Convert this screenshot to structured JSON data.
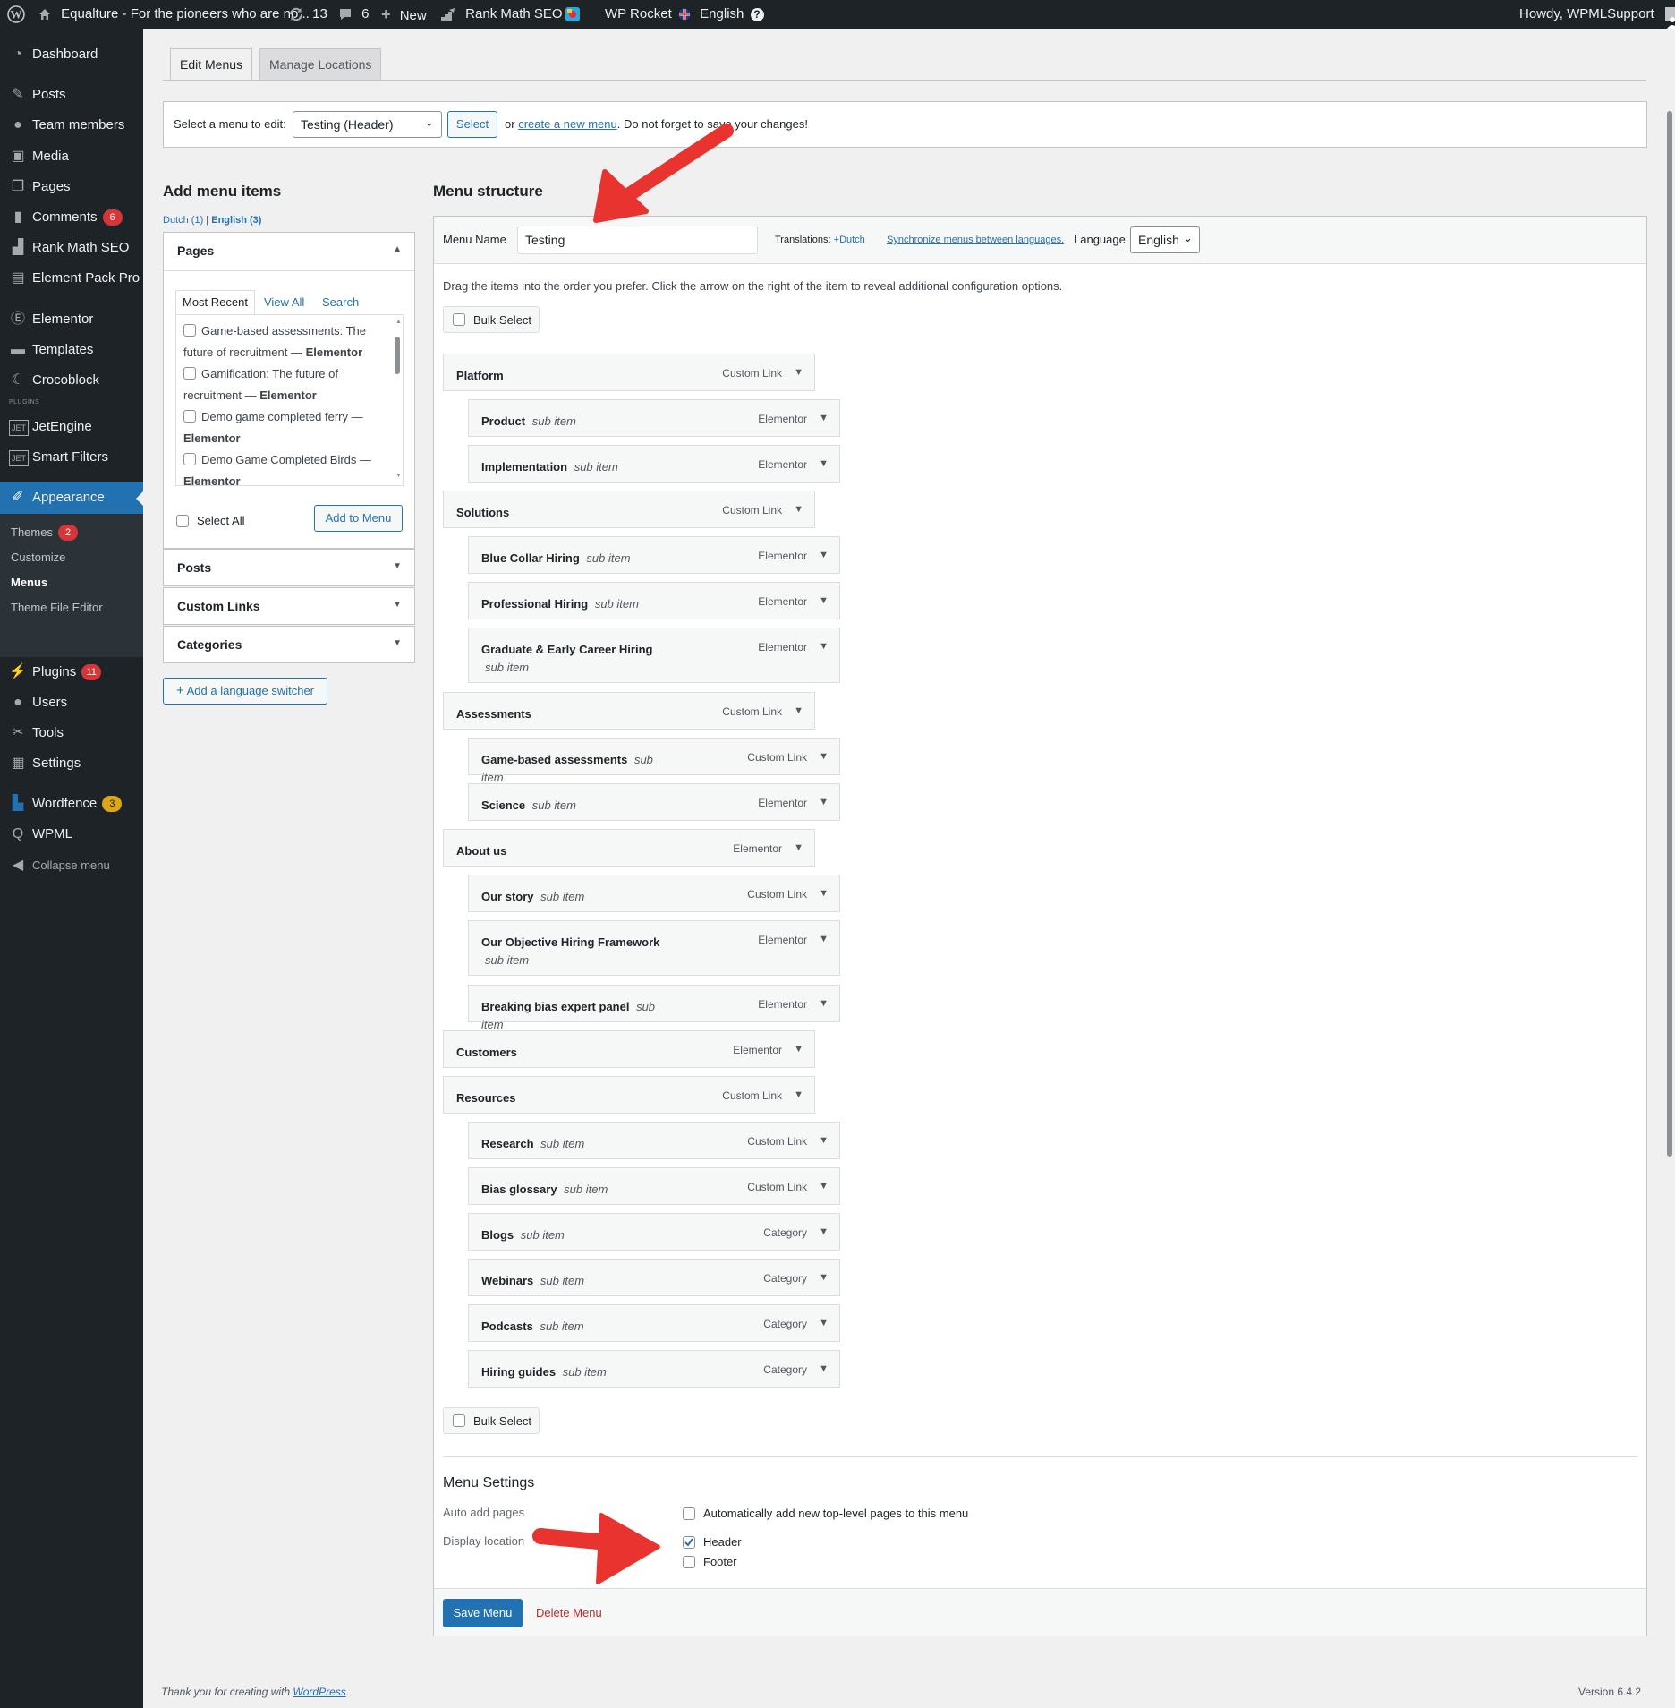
{
  "admin_bar": {
    "site_name": "Equalture - For the pioneers who are no...",
    "updates_count": "13",
    "comments_count": "6",
    "new_label": "New",
    "rankmath_label": "Rank Math SEO",
    "wprocket_label": "WP Rocket",
    "language_label": "English",
    "howdy": "Howdy, WPMLSupport"
  },
  "sidebar": {
    "dashboard": "Dashboard",
    "posts": "Posts",
    "team_members": "Team members",
    "media": "Media",
    "pages": "Pages",
    "comments": "Comments",
    "comments_badge": "6",
    "rankmath": "Rank Math SEO",
    "element_pack": "Element Pack Pro",
    "elementor": "Elementor",
    "templates": "Templates",
    "crocoblock": "Crocoblock",
    "plugins_separator": "PLUGINS",
    "jetengine": "JetEngine",
    "smart_filters": "Smart Filters",
    "appearance": "Appearance",
    "themes": "Themes",
    "themes_badge": "2",
    "customize": "Customize",
    "menus": "Menus",
    "theme_file_editor": "Theme File Editor",
    "plugins": "Plugins",
    "plugins_badge": "11",
    "users": "Users",
    "tools": "Tools",
    "settings": "Settings",
    "wordfence": "Wordfence",
    "wordfence_badge": "3",
    "wpml": "WPML",
    "collapse": "Collapse menu"
  },
  "tabs": {
    "edit_menus": "Edit Menus",
    "manage_locations": "Manage Locations"
  },
  "select_bar": {
    "label": "Select a menu to edit:",
    "selected": "Testing (Header)",
    "select_btn": "Select",
    "or": "or",
    "create_link": "create a new menu",
    "reminder": ". Do not forget to save your changes!"
  },
  "add_items": {
    "title": "Add menu items",
    "lang_dutch": "Dutch (1)",
    "lang_sep": "|",
    "lang_english": "English (3)",
    "pages_header": "Pages",
    "tab_recent": "Most Recent",
    "tab_view_all": "View All",
    "tab_search": "Search",
    "page_items": [
      {
        "title": "Game-based assessments: The future of recruitment — ",
        "suffix": "Elementor"
      },
      {
        "title": "Gamification: The future of recruitment — ",
        "suffix": "Elementor"
      },
      {
        "title": "Demo game completed ferry — ",
        "suffix": "Elementor"
      },
      {
        "title": "Demo Game Completed Birds — ",
        "suffix": "Elementor"
      }
    ],
    "select_all": "Select All",
    "add_to_menu": "Add to Menu",
    "posts_header": "Posts",
    "custom_links_header": "Custom Links",
    "categories_header": "Categories",
    "language_switcher": "Add a language switcher"
  },
  "structure": {
    "title": "Menu structure",
    "menu_name_label": "Menu Name",
    "menu_name_value": "Testing",
    "translations_label": "Translations:",
    "translations_dutch": "Dutch",
    "sync_link": "Synchronize menus between languages.",
    "language_label": "Language",
    "language_value": "English",
    "instructions": "Drag the items into the order you prefer. Click the arrow on the right of the item to reveal additional configuration options.",
    "bulk_select": "Bulk Select",
    "sub_item_text": "sub item",
    "items": [
      {
        "title": "Platform",
        "type": "Custom Link",
        "level": 0
      },
      {
        "title": "Product",
        "type": "Elementor",
        "level": 1
      },
      {
        "title": "Implementation",
        "type": "Elementor",
        "level": 1
      },
      {
        "title": "Solutions",
        "type": "Custom Link",
        "level": 0
      },
      {
        "title": "Blue Collar Hiring",
        "type": "Elementor",
        "level": 1
      },
      {
        "title": "Professional Hiring",
        "type": "Elementor",
        "level": 1
      },
      {
        "title": "Graduate & Early Career Hiring",
        "type": "Elementor",
        "level": 1
      },
      {
        "title": "Assessments",
        "type": "Custom Link",
        "level": 0
      },
      {
        "title": "Game-based assessments",
        "type": "Custom Link",
        "level": 1
      },
      {
        "title": "Science",
        "type": "Elementor",
        "level": 1
      },
      {
        "title": "About us",
        "type": "Elementor",
        "level": 0
      },
      {
        "title": "Our story",
        "type": "Custom Link",
        "level": 1
      },
      {
        "title": "Our Objective Hiring Framework",
        "type": "Elementor",
        "level": 1
      },
      {
        "title": "Breaking bias expert panel",
        "type": "Elementor",
        "level": 1
      },
      {
        "title": "Customers",
        "type": "Elementor",
        "level": 0
      },
      {
        "title": "Resources",
        "type": "Custom Link",
        "level": 0
      },
      {
        "title": "Research",
        "type": "Custom Link",
        "level": 1
      },
      {
        "title": "Bias glossary",
        "type": "Custom Link",
        "level": 1
      },
      {
        "title": "Blogs",
        "type": "Category",
        "level": 1
      },
      {
        "title": "Webinars",
        "type": "Category",
        "level": 1
      },
      {
        "title": "Podcasts",
        "type": "Category",
        "level": 1
      },
      {
        "title": "Hiring guides",
        "type": "Category",
        "level": 1
      }
    ]
  },
  "settings": {
    "title": "Menu Settings",
    "auto_add_label": "Auto add pages",
    "auto_add_text": "Automatically add new top-level pages to this menu",
    "display_location_label": "Display location",
    "header": "Header",
    "footer": "Footer",
    "save": "Save Menu",
    "delete": "Delete Menu"
  },
  "footer": {
    "thanks_prefix": "Thank you for creating with ",
    "thanks_link": "WordPress",
    "thanks_suffix": ".",
    "version": "Version 6.4.2"
  },
  "colors": {
    "admin_dark": "#1d2327",
    "accent_blue": "#2271b1",
    "annotation_red": "#e8332f"
  }
}
